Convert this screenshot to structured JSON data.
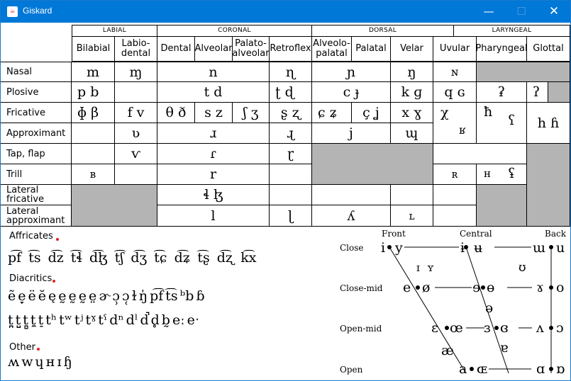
{
  "window": {
    "title": "Giskard",
    "app_icon": "java-icon",
    "min_icon": "minimize-icon",
    "max_icon": "maximize-icon",
    "close_icon": "close-icon"
  },
  "chart": {
    "groups": [
      "LABIAL",
      "CORONAL",
      "DORSAL",
      "LARYNGEAL"
    ],
    "places": [
      "Bilabial",
      "Labio-\ndental",
      "Dental",
      "Alveolar",
      "Palato-\nalveolar",
      "Retroflex",
      "Alveolo-\npalatal",
      "Palatal",
      "Velar",
      "Uvular",
      "Pharyngeal",
      "Glottal"
    ],
    "manners": [
      "Nasal",
      "Plosive",
      "Fricative",
      "Approximant",
      "Tap, flap",
      "Trill",
      "Lateral fricative",
      "Lateral approximant"
    ],
    "nasal": [
      "m",
      "ɱ",
      "n",
      "ɳ",
      "ɲ",
      "ŋ",
      "ɴ"
    ],
    "plosive": [
      "p b",
      "t d",
      "ʈ ɖ",
      "c ɟ",
      "k ɡ",
      "q ɢ",
      "ʡ",
      "ʔ"
    ],
    "fricative": [
      "ɸ β",
      "f v",
      "θ ð",
      "s z",
      "ʃ ʒ",
      "ʂ ʐ",
      "ɕ ʑ",
      "ç ʝ",
      "x ɣ",
      "χ",
      "ʁ",
      "ħ",
      "ʕ",
      "h ɦ"
    ],
    "approximant": [
      "ʋ",
      "ɹ",
      "ɻ",
      "j",
      "ɰ"
    ],
    "tap": [
      "ⱱ",
      "ɾ",
      "ɽ"
    ],
    "trill": [
      "ʙ",
      "r",
      "ʀ",
      "ʜ",
      "ʢ"
    ],
    "lateral_fricative": "ɬ ɮ",
    "lateral_approximant": [
      "l",
      "ɭ",
      "ʎ",
      "ʟ"
    ]
  },
  "affricates": {
    "label": "Affricates",
    "symbols": [
      "p͡f",
      "t͡s",
      "d͡z",
      "t͡ɬ",
      "d͡ɮ",
      "t͡ʃ",
      "d͡ʒ",
      "t͡ɕ",
      "d͡ʑ",
      "t͡ʂ",
      "d͡ʐ",
      "k͡x"
    ]
  },
  "diacritics": {
    "label": "Diacritics",
    "row1": [
      "ẽ",
      "e̞",
      "ë",
      "ĕ",
      "ę",
      "ḛ",
      "ḛ",
      "ḛ",
      "e̤",
      "ɚ",
      "ɔ̹",
      "ɔ̜",
      "ɫ",
      "ŋ̍",
      "p͡f",
      "t͡s",
      "ᵇb",
      "ɓ"
    ],
    "row2": [
      "t̪",
      "t̺",
      "t̻",
      "t̼",
      "t̠",
      "tʰ",
      "tʷ",
      "tʲ",
      "tˠ",
      "tˤ",
      "dⁿ",
      "dˡ",
      "d̚",
      "d̥",
      "b̰",
      "eː",
      "eˑ"
    ]
  },
  "other": {
    "label": "Other",
    "symbols": [
      "ʍ",
      "w",
      "ɥ",
      "ʜ",
      "ɪ",
      "ɧ"
    ]
  },
  "vowels": {
    "cols": [
      "Front",
      "Central",
      "Back"
    ],
    "rows": [
      "Close",
      "Close-mid",
      "Open-mid",
      "Open"
    ],
    "close": [
      "i",
      "y",
      "ɨ",
      "ʉ",
      "ɯ",
      "u"
    ],
    "near_close": [
      "ɪ",
      "ʏ",
      "ʊ"
    ],
    "close_mid": [
      "e",
      "ø",
      "ɘ",
      "ɵ",
      "ɤ",
      "o"
    ],
    "mid": "ə",
    "open_mid": [
      "ɛ",
      "œ",
      "ɜ",
      "ɞ",
      "ʌ",
      "ɔ"
    ],
    "near_open": [
      "æ",
      "ɐ"
    ],
    "open": [
      "a",
      "ɶ",
      "ɑ",
      "ɒ"
    ]
  }
}
